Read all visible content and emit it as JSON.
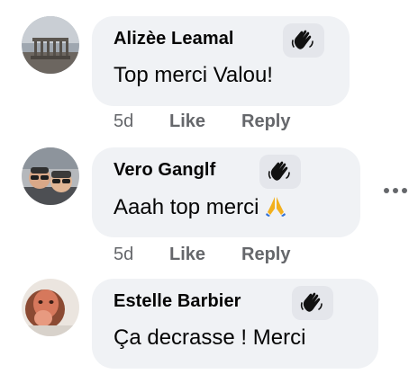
{
  "comments": [
    {
      "author": "Alizèe Leamal",
      "text": "Top merci Valou!",
      "time": "5d",
      "like_label": "Like",
      "reply_label": "Reply",
      "avatar_icon": "temple-photo-avatar",
      "badge_icon": "waving-hand-icon"
    },
    {
      "author": "Vero Ganglf",
      "text": "Aaah top merci",
      "emoji": "🙏",
      "emoji_icon": "folded-hands-icon",
      "time": "5d",
      "like_label": "Like",
      "reply_label": "Reply",
      "avatar_icon": "couple-selfie-avatar",
      "badge_icon": "waving-hand-icon",
      "more_icon": "more-options-icon"
    },
    {
      "author": "Estelle Barbier",
      "text": "Ça decrasse ! Merci",
      "avatar_icon": "portrait-photo-avatar",
      "badge_icon": "waving-hand-icon"
    }
  ],
  "colors": {
    "bubble": "#f0f2f5",
    "badge": "#e4e6eb",
    "name_text": "#050505",
    "meta_text": "#65676b",
    "prayer_emoji": "#f2b01e"
  }
}
